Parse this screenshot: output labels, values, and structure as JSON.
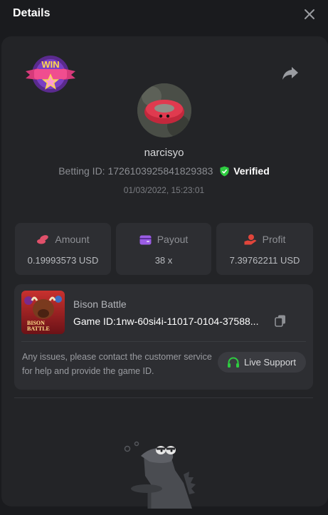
{
  "dialog": {
    "title": "Details"
  },
  "user": {
    "name": "narcisyo",
    "betting_id_label": "Betting ID:",
    "betting_id": "1726103925841829383",
    "verified_label": "Verified",
    "datetime": "01/03/2022, 15:23:01",
    "badge_text": "WIN"
  },
  "stats": {
    "amount": {
      "label": "Amount",
      "value": "0.19993573 USD",
      "icon": "coins-icon",
      "color": "#e0506a"
    },
    "payout": {
      "label": "Payout",
      "value": "38 x",
      "icon": "wallet-icon",
      "color": "#9b5de5"
    },
    "profit": {
      "label": "Profit",
      "value": "7.39762211 USD",
      "icon": "profit-hand-icon",
      "color": "#e0453b"
    }
  },
  "game": {
    "name": "Bison Battle",
    "id_label": "Game ID:",
    "id_value": "1nw-60si4i-11017-0104-37588...",
    "thumb_title_line1": "BISON",
    "thumb_title_line2": "BATTLE",
    "notice": "Any issues, please contact the customer service for help and provide the game ID.",
    "support_label": "Live Support"
  },
  "colors": {
    "verified": "#2ecc40",
    "support_icon": "#2ecc40",
    "panel": "#232427",
    "card": "#2d2e32"
  },
  "icons": [
    "close-icon",
    "share-icon",
    "verified-shield-icon",
    "copy-icon",
    "headset-icon",
    "win-badge-icon",
    "mascot-icon"
  ]
}
